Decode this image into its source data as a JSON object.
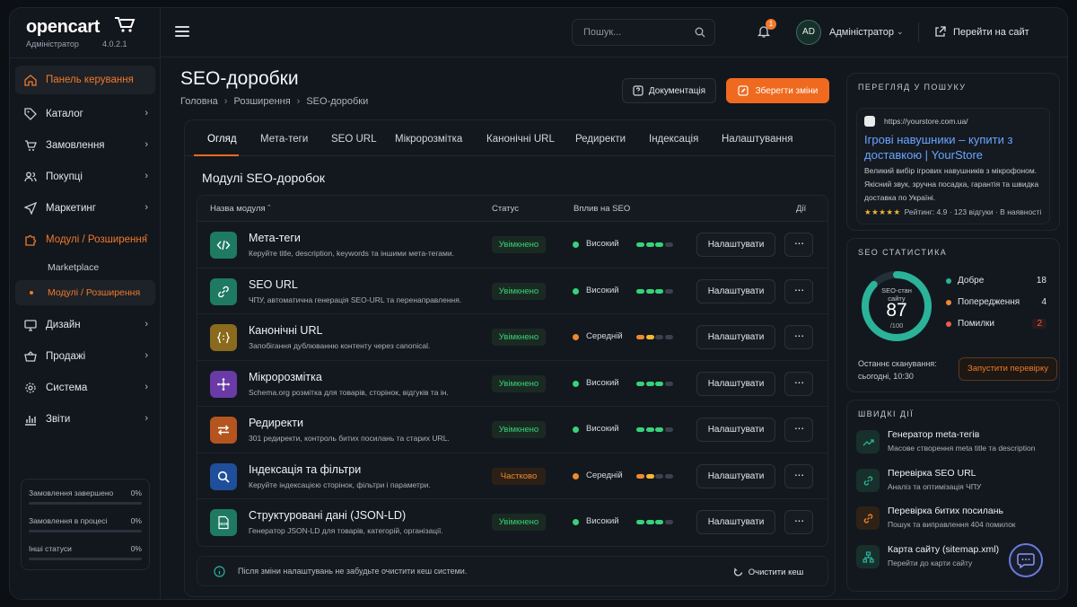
{
  "brand": {
    "logo": "opencart",
    "role": "Адміністратор",
    "version": "4.0.2.1"
  },
  "sidebar": {
    "items": [
      {
        "label": "Панель керування",
        "icon": "home-icon",
        "active": true
      },
      {
        "label": "Каталог",
        "icon": "tag-icon"
      },
      {
        "label": "Замовлення",
        "icon": "cart-icon"
      },
      {
        "label": "Покупці",
        "icon": "users-icon"
      },
      {
        "label": "Маркетинг",
        "icon": "send-icon"
      },
      {
        "label": "Модулі / Розширення",
        "icon": "puzzle-icon",
        "open": true
      },
      {
        "label": "Дизайн",
        "icon": "monitor-icon"
      },
      {
        "label": "Продажі",
        "icon": "basket-icon"
      },
      {
        "label": "Система",
        "icon": "gear-icon"
      },
      {
        "label": "Звіти",
        "icon": "chart-icon"
      }
    ],
    "sub_items": [
      {
        "label": "Marketplace"
      },
      {
        "label": "Модулі / Розширення",
        "current": true
      }
    ],
    "stats": [
      {
        "label": "Замовлення завершено",
        "value": "0%"
      },
      {
        "label": "Замовлення в процесі",
        "value": "0%"
      },
      {
        "label": "Інші статуси",
        "value": "0%"
      }
    ]
  },
  "header": {
    "search_placeholder": "Пошук...",
    "notifications": "1",
    "user_initials": "AD",
    "user_name": "Адміністратор",
    "goto_site": "Перейти на сайт"
  },
  "page": {
    "title": "SEO-доробки",
    "breadcrumb": [
      "Головна",
      "Розширення",
      "SEO-доробки"
    ],
    "doc_button": "Документація",
    "save_button": "Зберегти зміни"
  },
  "tabs": [
    "Огляд",
    "Мета-теги",
    "SEO URL",
    "Мікророзмітка",
    "Канонічні URL",
    "Редиректи",
    "Індексація",
    "Налаштування"
  ],
  "modules": {
    "title": "Модулі SEO-доробок",
    "columns": {
      "name": "Назва модуля",
      "status": "Статус",
      "impact": "Вплив на SEO",
      "actions": "Дії"
    },
    "configure_label": "Налаштувати",
    "rows": [
      {
        "name": "Мета-теги",
        "desc": "Керуйте title, description, keywords та іншими мета-тегами.",
        "status": "Увімкнено",
        "status_kind": "on",
        "impact": "Високий",
        "impact_level": 3,
        "icon": "code-icon",
        "color": "#1f7a62"
      },
      {
        "name": "SEO URL",
        "desc": "ЧПУ, автоматична генерація SEO-URL та перенаправлення.",
        "status": "Увімкнено",
        "status_kind": "on",
        "impact": "Високий",
        "impact_level": 3,
        "icon": "link-icon",
        "color": "#1f7a62"
      },
      {
        "name": "Канонічні URL",
        "desc": "Запобігання дублюванню контенту через canonical.",
        "status": "Увімкнено",
        "status_kind": "on",
        "impact": "Середній",
        "impact_level": 2,
        "icon": "braces-icon",
        "color": "#8a6a1c"
      },
      {
        "name": "Мікророзмітка",
        "desc": "Schema.org розмітка для товарів, сторінок, відгуків та ін.",
        "status": "Увімкнено",
        "status_kind": "on",
        "impact": "Високий",
        "impact_level": 3,
        "icon": "network-icon",
        "color": "#6a3aa6"
      },
      {
        "name": "Редиректи",
        "desc": "301 редиректи, контроль битих посилань та старих URL.",
        "status": "Увімкнено",
        "status_kind": "on",
        "impact": "Високий",
        "impact_level": 3,
        "icon": "arrows-icon",
        "color": "#b4541e"
      },
      {
        "name": "Індексація та фільтри",
        "desc": "Керуйте індексацією сторінок, фільтри і параметри.",
        "status": "Частково",
        "status_kind": "partial",
        "impact": "Середній",
        "impact_level": 2,
        "icon": "search-icon",
        "color": "#1f4f9a"
      },
      {
        "name": "Структуровані дані (JSON-LD)",
        "desc": "Генератор JSON-LD для товарів, категорій, організації.",
        "status": "Увімкнено",
        "status_kind": "on",
        "impact": "Високий",
        "impact_level": 3,
        "icon": "json-file-icon",
        "color": "#1f7a62"
      }
    ],
    "notice": "Після зміни налаштувань не забудьте очистити кеш системи.",
    "clear_cache": "Очистити кеш"
  },
  "serp": {
    "title": "ПЕРЕГЛЯД У ПОШУКУ",
    "url": "https://yourstore.com.ua/",
    "heading": "Ігрові навушники – купити з доставкою | YourStore",
    "description": "Великий вибір ігрових навушників з мікрофоном. Якісний звук, зручна посадка, гарантія та швидка доставка по Україні.",
    "stars": "★★★★★",
    "rating": "Рейтинг: 4.9 · 123 відгуки · В наявності"
  },
  "seo_stats": {
    "title": "SEO СТАТИСТИКА",
    "gauge_label": "SEO-стан сайту",
    "score": "87",
    "score_max": "/100",
    "score_fraction": 0.87,
    "legend": [
      {
        "label": "Добре",
        "value": "18",
        "color": "#2bb39a"
      },
      {
        "label": "Попередження",
        "value": "4",
        "color": "#f0892e"
      },
      {
        "label": "Помилки",
        "value": "2",
        "color": "#ef5a4f"
      }
    ],
    "scan_label": "Останнє сканування:",
    "scan_time": "сьогодні, 10:30",
    "run_button": "Запустити перевірку"
  },
  "quick_actions": {
    "title": "ШВИДКІ ДІЇ",
    "items": [
      {
        "title": "Генератор meta-тегів",
        "desc": "Масове створення meta title та description",
        "icon": "trend-icon"
      },
      {
        "title": "Перевірка SEO URL",
        "desc": "Аналіз та оптимізація ЧПУ",
        "icon": "link-icon"
      },
      {
        "title": "Перевірка битих посилань",
        "desc": "Пошук та виправлення 404 помилок",
        "icon": "broken-link-icon"
      },
      {
        "title": "Карта сайту (sitemap.xml)",
        "desc": "Перейти до карти сайту",
        "icon": "sitemap-icon"
      }
    ]
  },
  "colors": {
    "accent": "#ef6a1f",
    "good": "#38d27a",
    "teal": "#2bb39a"
  }
}
